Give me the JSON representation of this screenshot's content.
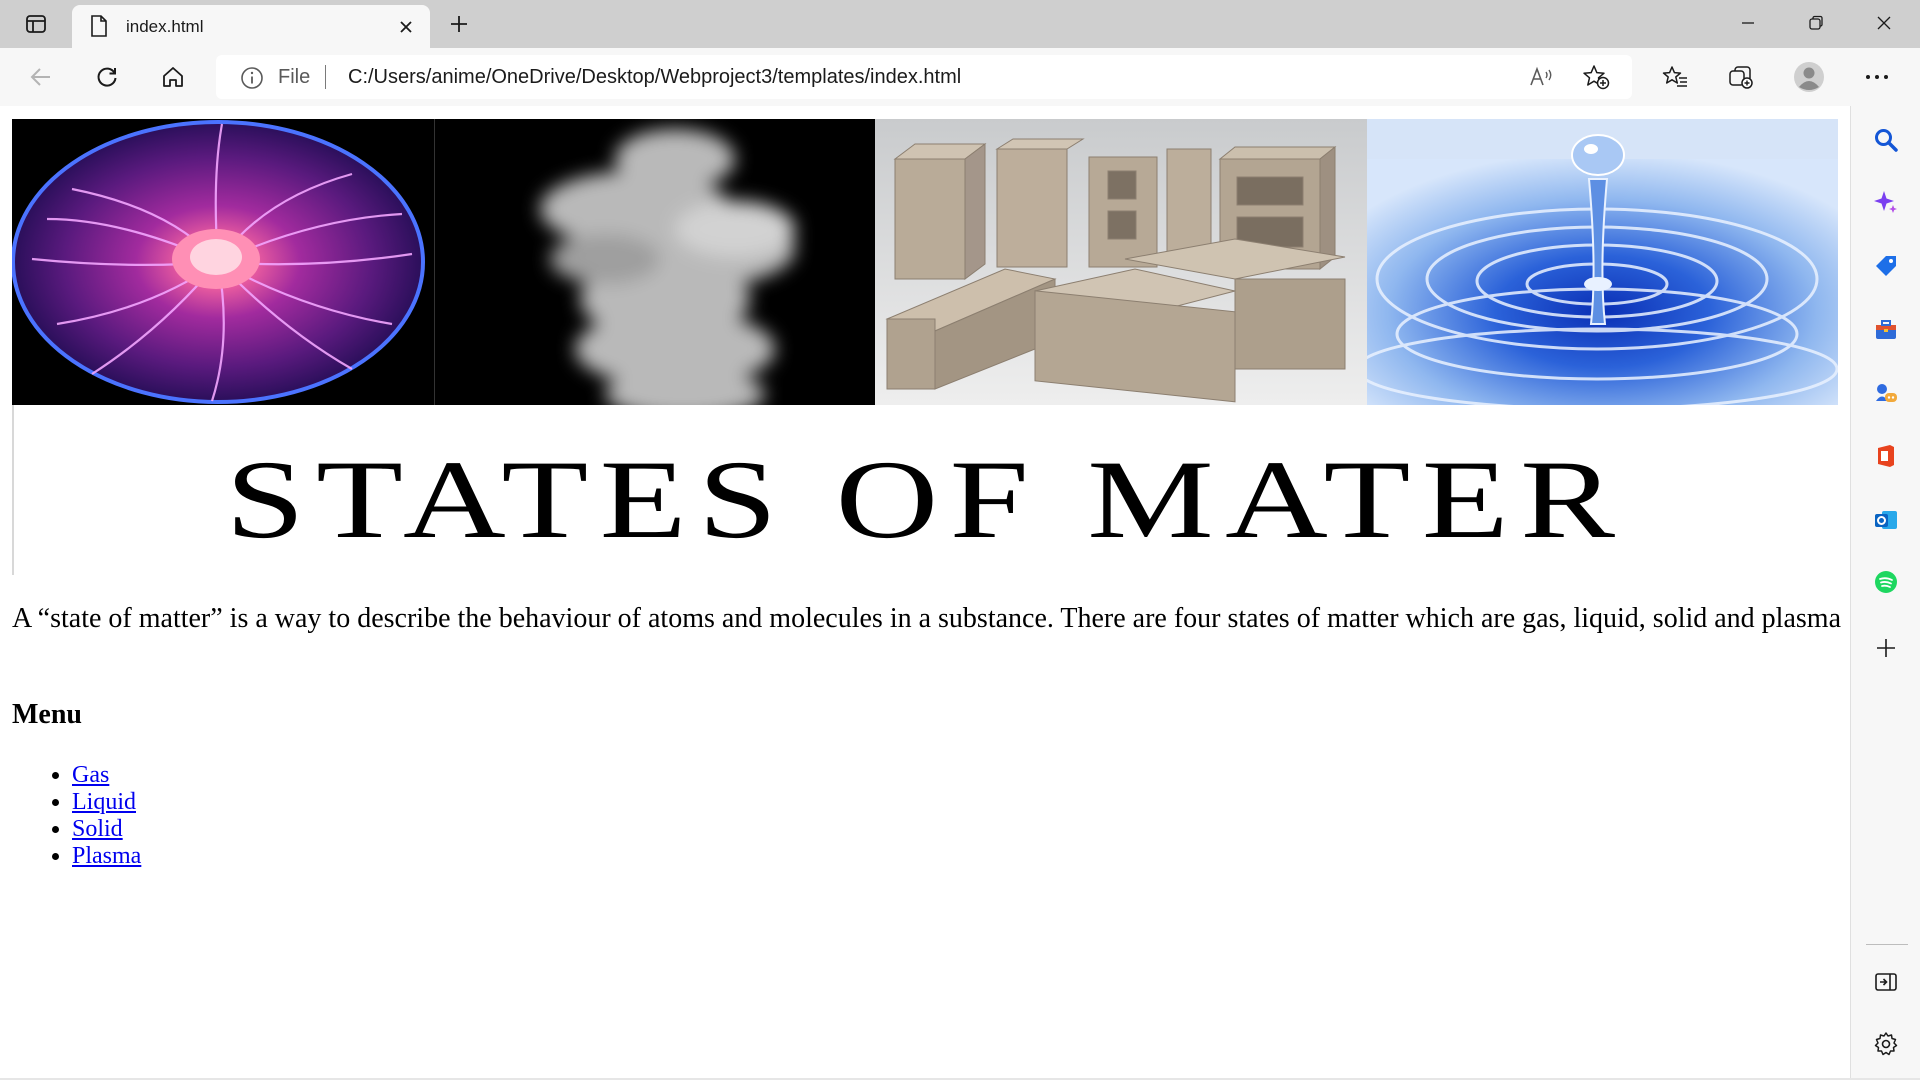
{
  "browser": {
    "tab_title": "index.html",
    "address_scheme": "File",
    "address_url": "C:/Users/anime/OneDrive/Desktop/Webproject3/templates/index.html"
  },
  "page": {
    "banner_images": [
      "plasma-ball",
      "gas-smoke",
      "solid-bricks",
      "liquid-water-drop"
    ],
    "title": "STATES OF MATER",
    "intro": "A “state of matter” is a way to describe the behaviour of atoms and molecules in a substance. There are four states of matter which are gas, liquid, solid and plasma",
    "menu_heading": "Menu",
    "menu_items": [
      "Gas",
      "Liquid",
      "Solid",
      "Plasma"
    ]
  },
  "colors": {
    "link": "#0000ee",
    "tabstrip": "#cfcfcf",
    "toolbar": "#f7f7f7"
  },
  "icons": {
    "sidebar": [
      "search-icon",
      "copilot-sparkle-icon",
      "shopping-tag-icon",
      "tools-briefcase-icon",
      "games-icon",
      "office-icon",
      "outlook-icon",
      "spotify-icon",
      "add-icon",
      "hide-sidebar-icon",
      "settings-icon"
    ]
  }
}
